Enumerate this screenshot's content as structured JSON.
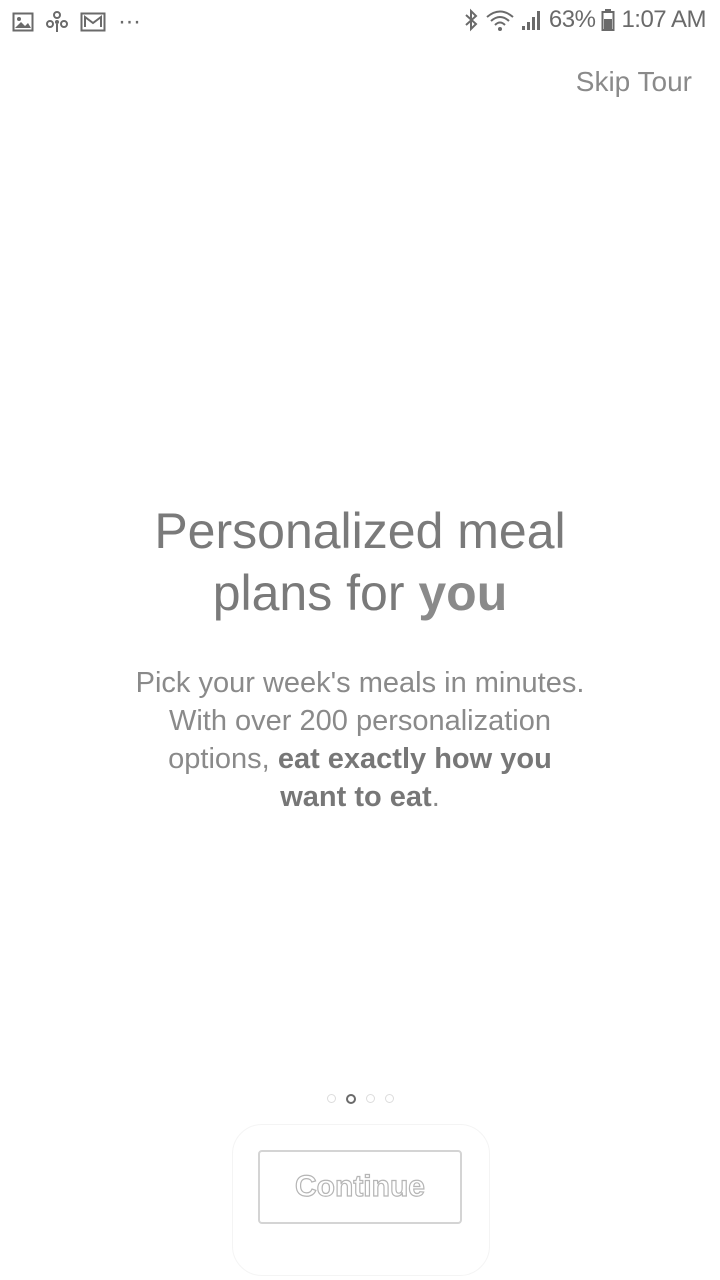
{
  "status_bar": {
    "left_icons": [
      "image-icon",
      "pinwheel-icon",
      "gmail-icon"
    ],
    "more": "···",
    "right_icons": [
      "bluetooth-icon",
      "wifi-icon",
      "signal-icon"
    ],
    "battery_percent": "63%",
    "time": "1:07 AM"
  },
  "skip_label": "Skip Tour",
  "headline": {
    "line1": "Personalized meal",
    "line2_plain": "plans for ",
    "line2_bold": "you"
  },
  "subtitle": {
    "line1": "Pick your week's meals in minutes.",
    "line2": "With over 200 personalization",
    "line3_plain": "options, ",
    "line3_bold": "eat exactly how you",
    "line4_bold": "want to eat",
    "line4_plain": "."
  },
  "pager": {
    "total": 4,
    "active_index": 1
  },
  "continue_label": "Continue"
}
